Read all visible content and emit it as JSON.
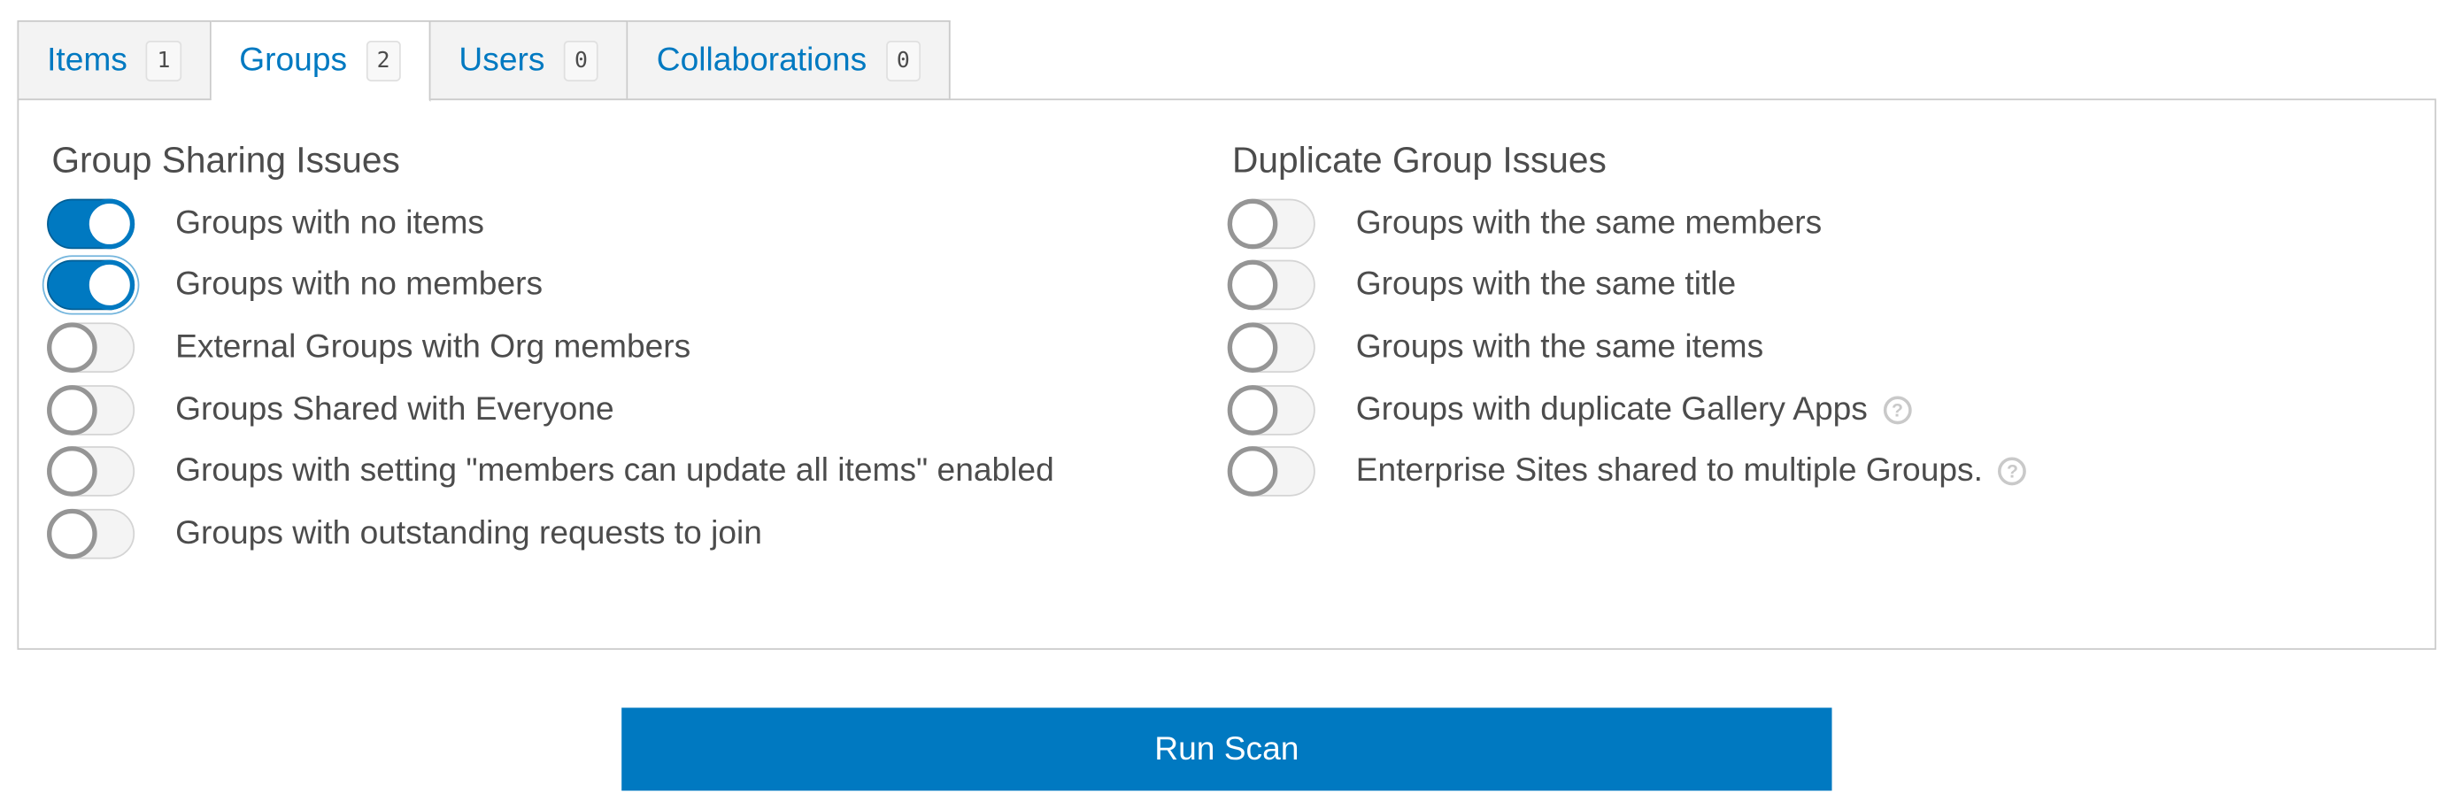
{
  "tabs": [
    {
      "label": "Items",
      "count": "1",
      "active": false
    },
    {
      "label": "Groups",
      "count": "2",
      "active": true
    },
    {
      "label": "Users",
      "count": "0",
      "active": false
    },
    {
      "label": "Collaborations",
      "count": "0",
      "active": false
    }
  ],
  "sharing": {
    "title": "Group Sharing Issues",
    "items": [
      {
        "label": "Groups with no items",
        "enabled": true
      },
      {
        "label": "Groups with no members",
        "enabled": true
      },
      {
        "label": "External Groups with Org members",
        "enabled": false
      },
      {
        "label": "Groups Shared with Everyone",
        "enabled": false
      },
      {
        "label": "Groups with setting \"members can update all items\" enabled",
        "enabled": false
      },
      {
        "label": "Groups with outstanding requests to join",
        "enabled": false
      }
    ]
  },
  "duplicates": {
    "title": "Duplicate Group Issues",
    "items": [
      {
        "label": "Groups with the same members",
        "enabled": false
      },
      {
        "label": "Groups with the same title",
        "enabled": false
      },
      {
        "label": "Groups with the same items",
        "enabled": false
      },
      {
        "label": "Groups with duplicate Gallery Apps",
        "enabled": false,
        "help": "?"
      },
      {
        "label": "Enterprise Sites shared to multiple Groups.",
        "enabled": false,
        "help": "?"
      }
    ]
  },
  "run_button": {
    "label": "Run Scan"
  },
  "colors": {
    "accent": "#0079c1",
    "text": "#4c4c4c",
    "border": "#cacaca"
  }
}
